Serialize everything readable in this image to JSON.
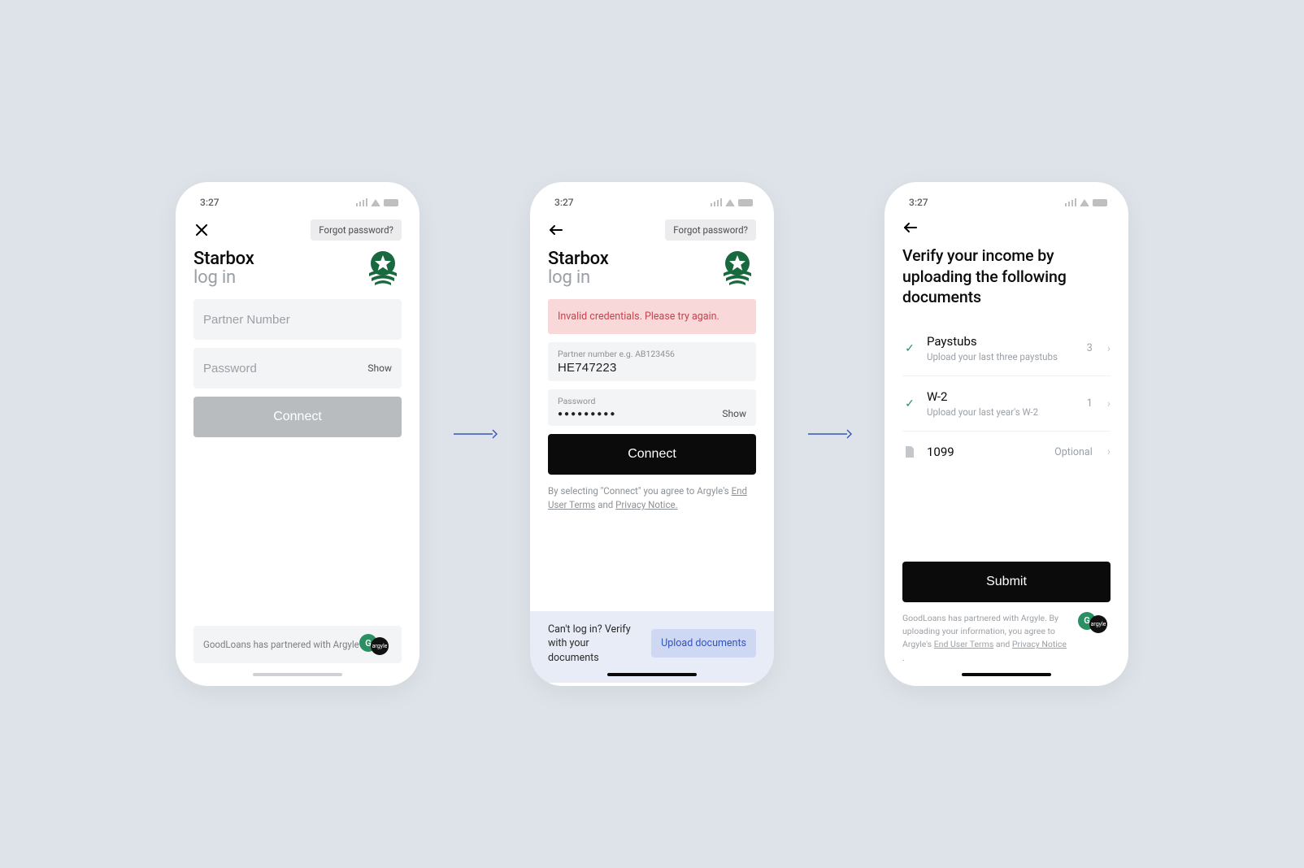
{
  "statusbar": {
    "time": "3:27"
  },
  "screen1": {
    "forgot": "Forgot password?",
    "title": "Starbox",
    "subtitle": "log in",
    "partner_placeholder": "Partner Number",
    "password_placeholder": "Password",
    "show": "Show",
    "connect": "Connect",
    "footer": "GoodLoans has partnered with Argyle",
    "logo_g": "G",
    "logo_b": "argyle"
  },
  "screen2": {
    "forgot": "Forgot password?",
    "title": "Starbox",
    "subtitle": "log in",
    "error": "Invalid credentials. Please try again.",
    "partner_label": "Partner number e.g. AB123456",
    "partner_value": "HE747223",
    "password_label": "Password",
    "password_value": "●●●●●●●●●",
    "show": "Show",
    "connect": "Connect",
    "legal_prefix": "By selecting \"Connect\" you agree to Argyle's ",
    "legal_terms": "End User Terms",
    "legal_and": " and ",
    "legal_privacy": "Privacy Notice.",
    "fallback_text": "Can't log in? Verify with your documents",
    "fallback_cta": "Upload documents"
  },
  "screen3": {
    "title": "Verify your income by uploading the following documents",
    "docs": [
      {
        "title": "Paystubs",
        "sub": "Upload your last three paystubs",
        "meta": "3",
        "done": true
      },
      {
        "title": "W-2",
        "sub": "Upload your last year's W-2",
        "meta": "1",
        "done": true
      },
      {
        "title": "1099",
        "sub": "",
        "meta": "Optional",
        "done": false
      }
    ],
    "submit": "Submit",
    "legal_prefix": "GoodLoans has partnered with Argyle. By uploading your information, you agree to Argyle's ",
    "legal_terms": "End User Terms",
    "legal_and": " and ",
    "legal_privacy": "Privacy Notice",
    "legal_tail": " .",
    "logo_g": "G",
    "logo_b": "argyle"
  }
}
